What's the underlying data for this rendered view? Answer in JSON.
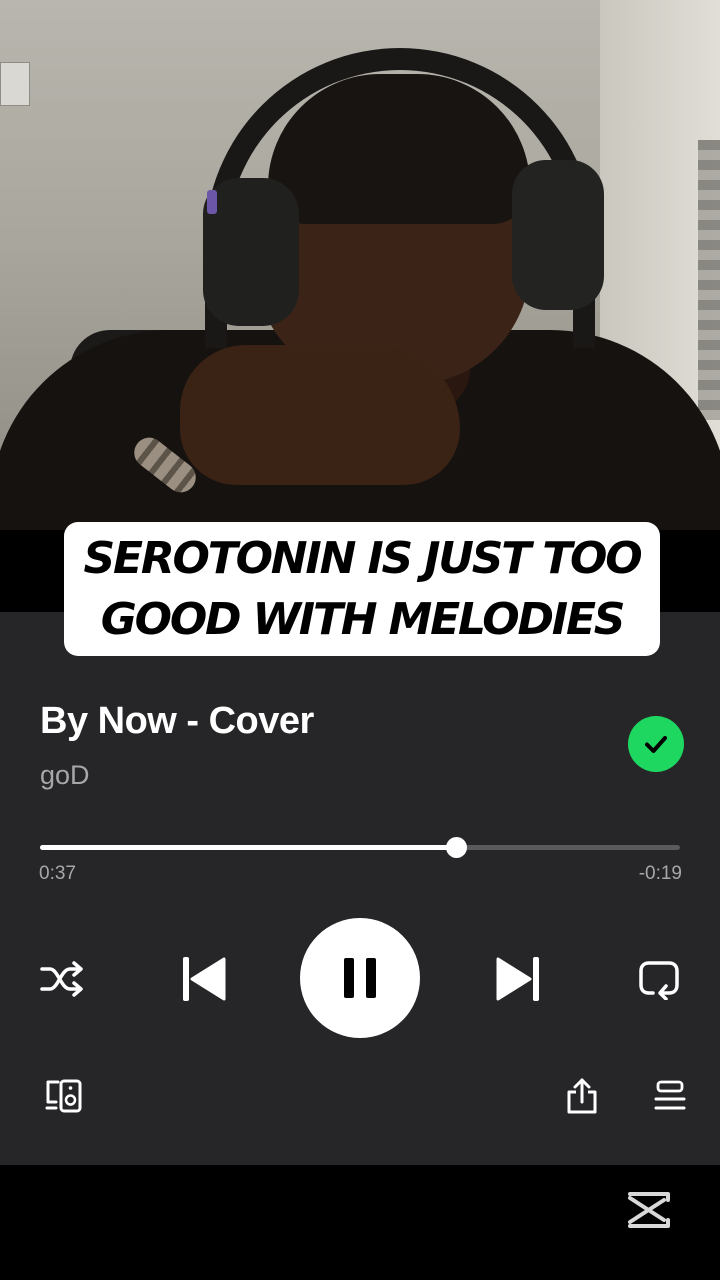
{
  "caption": {
    "line1": "SEROTONIN IS JUST TOO",
    "line2": "GOOD WITH MELODIES"
  },
  "player": {
    "track_title": "By Now - Cover",
    "artist": "goD",
    "liked": true,
    "elapsed": "0:37",
    "remaining": "-0:19",
    "progress_fraction": 0.65,
    "accent_color": "#1ed760",
    "controls": {
      "shuffle_icon": "shuffle-icon",
      "previous_icon": "skip-previous-icon",
      "play_pause_icon": "pause-icon",
      "next_icon": "skip-next-icon",
      "repeat_icon": "repeat-icon",
      "devices_icon": "connect-device-icon",
      "share_icon": "share-icon",
      "queue_icon": "queue-icon"
    }
  },
  "watermark": {
    "icon": "capcut-logo-icon"
  }
}
